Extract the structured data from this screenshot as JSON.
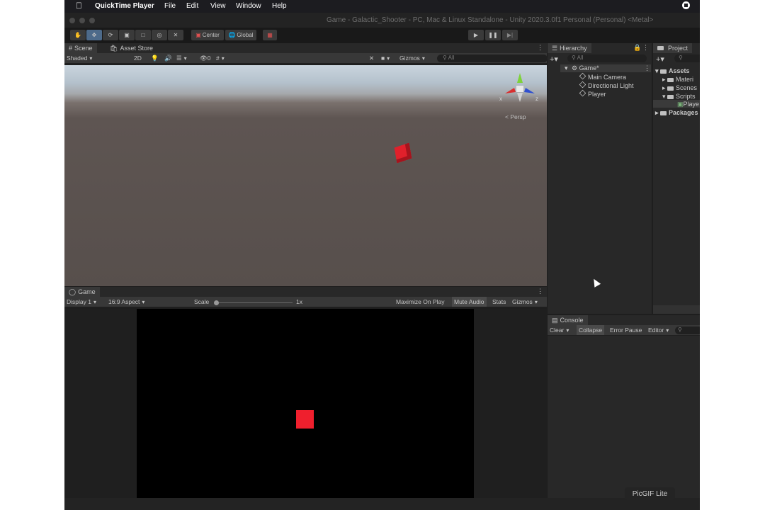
{
  "menubar": {
    "app": "QuickTime Player",
    "items": [
      "File",
      "Edit",
      "View",
      "Window",
      "Help"
    ]
  },
  "window": {
    "title": "Game - Galactic_Shooter - PC, Mac & Linux Standalone - Unity 2020.3.0f1 Personal (Personal) <Metal>"
  },
  "toolbar": {
    "pivot": "Center",
    "space": "Global"
  },
  "scene": {
    "tabs": [
      "Scene",
      "Asset Store"
    ],
    "draw_mode": "Shaded",
    "mode_2d": "2D",
    "hidden_count": "0",
    "gizmos": "Gizmos",
    "search_placeholder": "All",
    "projection": "< Persp",
    "axes": {
      "x": "x",
      "z": "z"
    }
  },
  "game": {
    "tab": "Game",
    "display": "Display 1",
    "aspect": "16:9 Aspect",
    "scale_label": "Scale",
    "scale_value": "1x",
    "maximize": "Maximize On Play",
    "mute": "Mute Audio",
    "stats": "Stats",
    "gizmos": "Gizmos"
  },
  "hierarchy": {
    "tab": "Hierarchy",
    "search_placeholder": "All",
    "scene": "Game*",
    "items": [
      "Main Camera",
      "Directional Light",
      "Player"
    ]
  },
  "project": {
    "tab": "Project",
    "root": "Assets",
    "folders": [
      "Materi",
      "Scenes",
      "Scripts"
    ],
    "script_file": "Playe",
    "packages": "Packages"
  },
  "console": {
    "tab": "Console",
    "clear": "Clear",
    "collapse": "Collapse",
    "error_pause": "Error Pause",
    "editor": "Editor"
  },
  "watermark": "PicGIF Lite",
  "colors": {
    "cube": "#ef1f2d",
    "accent": "#4d6a8a"
  }
}
